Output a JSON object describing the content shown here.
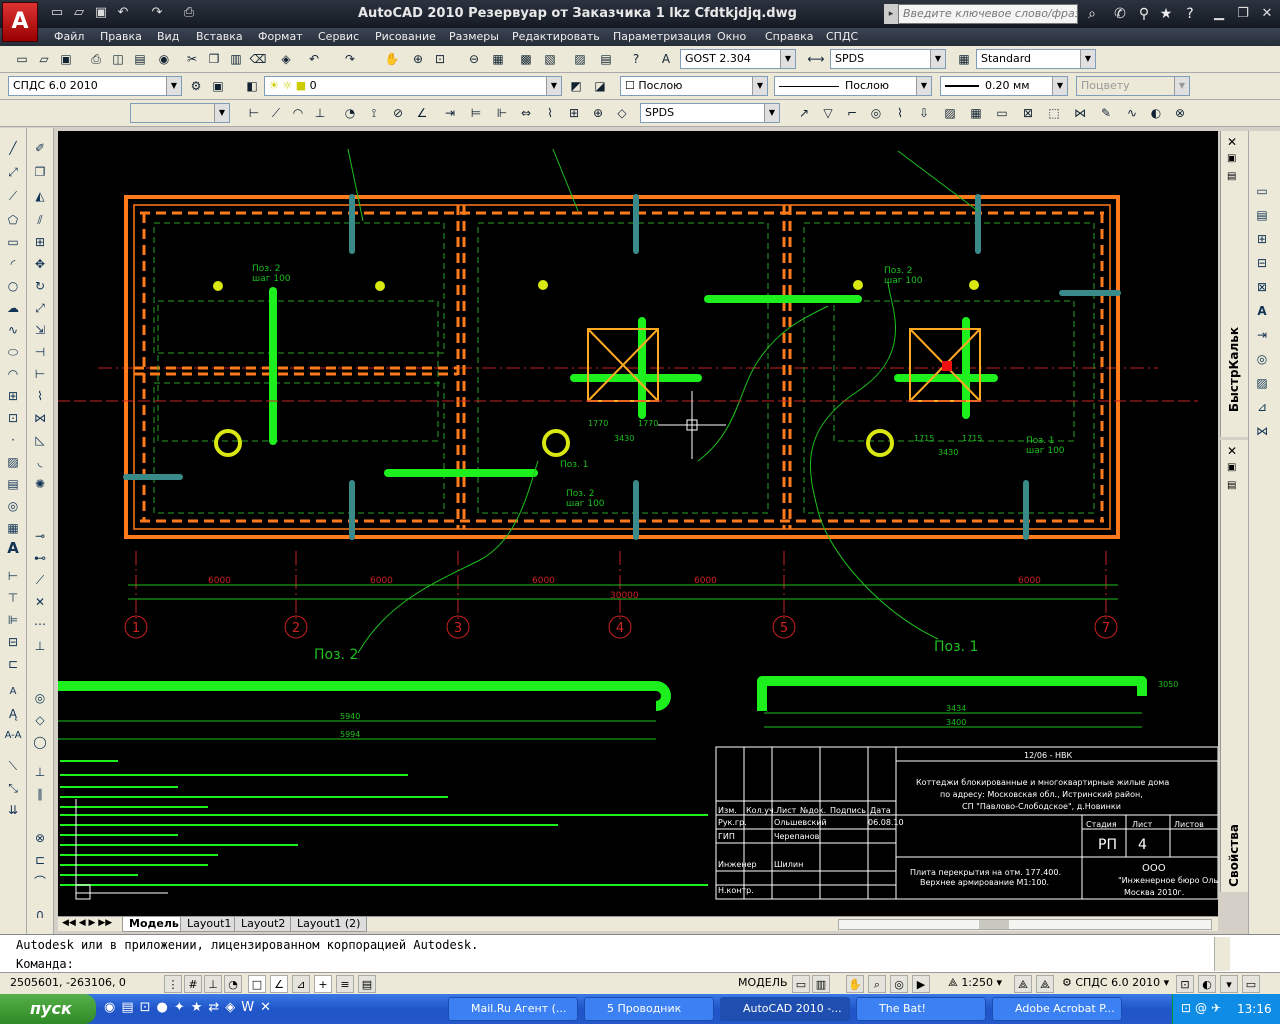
{
  "app": {
    "title": "AutoCAD 2010    Резервуар от Заказчика 1 lkz Cfdtkjdjq.dwg",
    "logo_letter": "A",
    "search_placeholder": "Введите ключевое слово/фразу"
  },
  "menu": [
    "Файл",
    "Правка",
    "Вид",
    "Вставка",
    "Формат",
    "Сервис",
    "Рисование",
    "Размеры",
    "Редактировать",
    "Параметризация",
    "Окно",
    "Справка",
    "СПДС"
  ],
  "toolbar1": {
    "text_style": "GOST 2.304",
    "dim_style": "SPDS",
    "table_style": "Standard"
  },
  "toolbar2": {
    "workspace": "СПДС 6.0 2010",
    "layer": "0",
    "color": "Послою",
    "linetype": "Послою",
    "lineweight": "0.20 мм",
    "plotstyle": "Поцвету"
  },
  "toolbar3": {
    "style": "SPDS"
  },
  "right_panels": {
    "quickcalc": "БыстрКальк",
    "properties": "Свойства"
  },
  "drawing": {
    "pos2_label": "Поз. 2",
    "pos1_label": "Поз. 1",
    "axes": [
      "1",
      "2",
      "3",
      "4",
      "5",
      "7"
    ],
    "dims": {
      "span": "6000",
      "total": "30000",
      "bar2_a": "5940",
      "bar2_b": "5994",
      "bar1_a": "3434",
      "bar1_b": "3400",
      "bar1_c": "3050"
    },
    "callout_pos2": "Поз. 2",
    "callout_shb": "шаг 100",
    "callout_pos1": "Поз. 1",
    "col_dims": [
      "1770",
      "1770",
      "1715",
      "1715",
      "3430",
      "3430"
    ],
    "title_block": {
      "code": "12/06 - НВК",
      "desc1": "Коттеджи блокированные и многоквартирные жилые дома",
      "desc2": "по адресу: Московская обл., Истринский район,",
      "desc3": "СП \"Павлово-Слободское\", д.Новинки",
      "sheet_title1": "Плита перекрытия на отм. 177.400.",
      "sheet_title2": "Верхнее армирование М1:100.",
      "hdr": [
        "Изм.",
        "Кол.уч.",
        "Лист",
        "№док.",
        "Подпись",
        "Дата"
      ],
      "roles": [
        "Рук.гр.",
        "ГИП",
        "Инженер",
        "Н.контр."
      ],
      "names": [
        "Ольшевский",
        "Черепанов",
        "Шилин"
      ],
      "date": "06.08.10",
      "stage_hdr": "Стадия",
      "sheet_hdr": "Лист",
      "sheets_hdr": "Листов",
      "stage": "РП",
      "sheet": "4",
      "org1": "ООО",
      "org2": "\"Инженерное бюро Ольшевского\"",
      "city": "Москва 2010г."
    }
  },
  "tabs": [
    "Модель",
    "Layout1",
    "Layout2",
    "Layout1 (2)"
  ],
  "command": {
    "line1": "Autodesk или в приложении, лицензированном корпорацией Autodesk.",
    "prompt": "Команда:"
  },
  "status": {
    "coords": "2505601, -263106, 0",
    "model": "МОДЕЛЬ",
    "scale": "1:250",
    "workspace": "СПДС 6.0 2010"
  },
  "taskbar": {
    "start": "пуск",
    "tasks": [
      "Mail.Ru Агент (...",
      "5 Проводник",
      "AutoCAD 2010 -...",
      "The Bat!",
      "Adobe Acrobat P..."
    ],
    "time": "13:16"
  }
}
